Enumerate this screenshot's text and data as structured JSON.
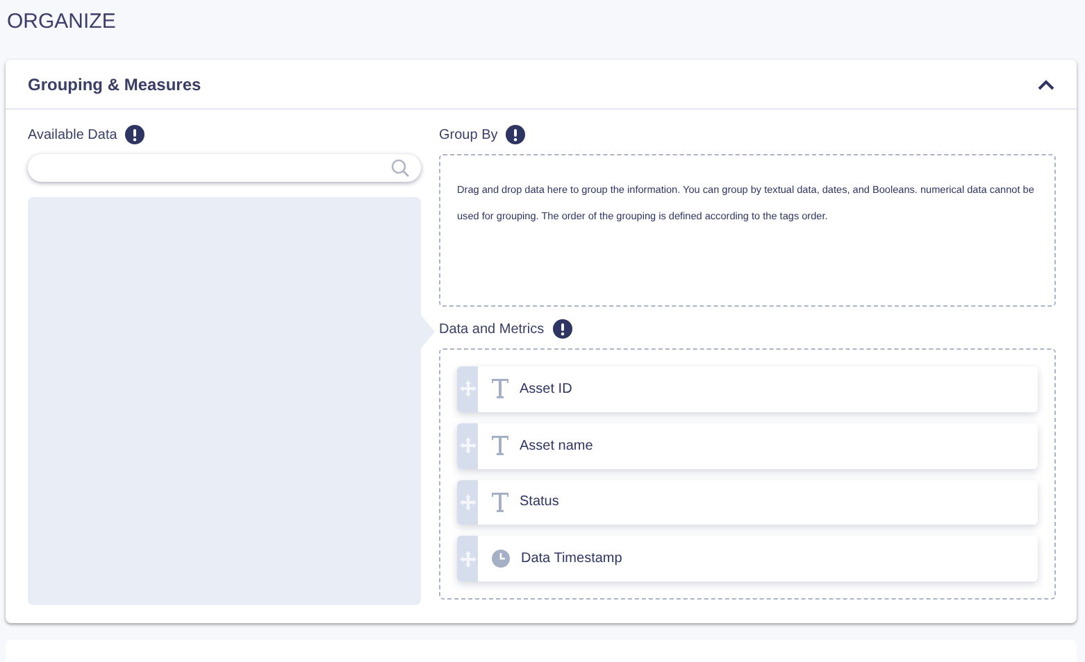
{
  "page_title": "ORGANIZE",
  "section": {
    "title": "Grouping & Measures",
    "expanded": true
  },
  "available_data": {
    "label": "Available Data"
  },
  "group_by": {
    "label": "Group By",
    "hint": "Drag and drop data here to group the information. You can group by textual data, dates, and Booleans. numerical data cannot be used for grouping. The order of the grouping is defined according to the tags order."
  },
  "data_and_metrics": {
    "label": "Data and Metrics",
    "items": [
      {
        "label": "Asset ID",
        "kind": "text"
      },
      {
        "label": "Asset name",
        "kind": "text"
      },
      {
        "label": "Status",
        "kind": "text"
      },
      {
        "label": "Data Timestamp",
        "kind": "date"
      }
    ]
  }
}
